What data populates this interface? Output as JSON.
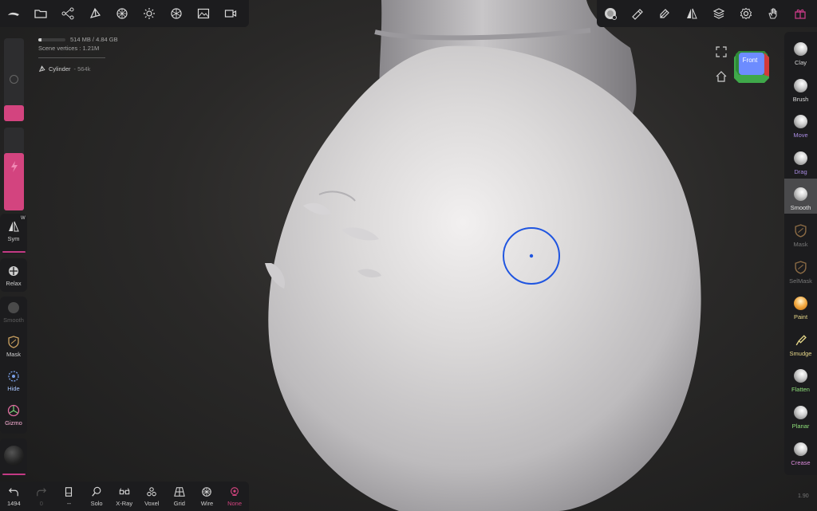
{
  "stats": {
    "memory": "514 MB / 4.84 GB",
    "memory_used_fraction": 0.106,
    "scene_vertices": "Scene vertices : 1.21M",
    "object_name": "Cylinder",
    "object_vertices": "564k"
  },
  "left": {
    "sym_label": "Sym",
    "sym_badge": "W",
    "relax_label": "Relax",
    "smooth_label": "Smooth",
    "mask_label": "Mask",
    "hide_label": "Hide",
    "gizmo_label": "Gizmo"
  },
  "bottom": {
    "undo_count": "1494",
    "redo_count": "0",
    "dots": "--",
    "solo": "Solo",
    "xray": "X-Ray",
    "voxel": "Voxel",
    "grid": "Grid",
    "wire": "Wire",
    "none": "None"
  },
  "right_tools": [
    {
      "label": "Clay",
      "color": "#d8d8d8"
    },
    {
      "label": "Brush",
      "color": "#d8d8d8"
    },
    {
      "label": "Move",
      "color": "#a88be0"
    },
    {
      "label": "Drag",
      "color": "#a88be0"
    },
    {
      "label": "Smooth",
      "color": "#e6e6e6"
    },
    {
      "label": "Mask",
      "color": "#777777"
    },
    {
      "label": "SelMask",
      "color": "#777777"
    },
    {
      "label": "Paint",
      "color": "#e8d98a"
    },
    {
      "label": "Smudge",
      "color": "#e8d98a"
    },
    {
      "label": "Flatten",
      "color": "#8fe07a"
    },
    {
      "label": "Planar",
      "color": "#8fe07a"
    },
    {
      "label": "Crease",
      "color": "#d98ad9"
    }
  ],
  "cube_label": "Front",
  "version": "1.90",
  "colors": {
    "accent": "#c43a84",
    "cursor": "#1f55e0",
    "panel": "#1c1c1e"
  }
}
